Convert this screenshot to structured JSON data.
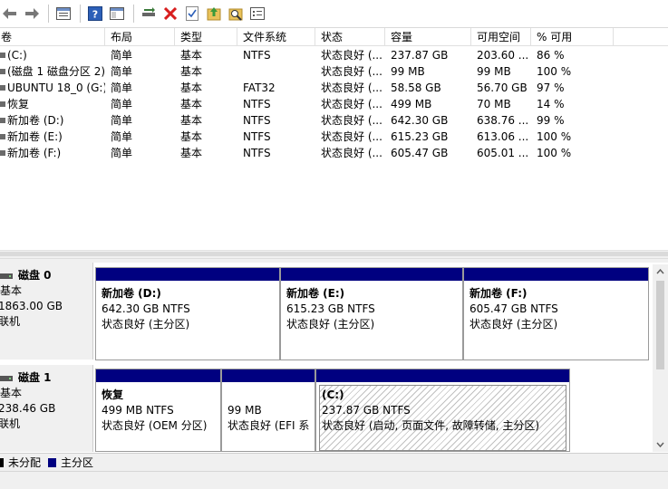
{
  "toolbar": {
    "buttons": [
      "back-icon",
      "forward-icon",
      "view-icon",
      "help-icon",
      "panel-icon",
      "connect-icon",
      "delete-icon",
      "check-icon",
      "refresh-icon",
      "search-icon",
      "properties-icon"
    ]
  },
  "columns": [
    "卷",
    "布局",
    "类型",
    "文件系统",
    "状态",
    "容量",
    "可用空间",
    "% 可用"
  ],
  "rows": [
    {
      "vol": "(C:)",
      "layout": "简单",
      "type": "基本",
      "fs": "NTFS",
      "status": "状态良好 (...",
      "cap": "237.87 GB",
      "free": "203.60 ...",
      "pct": "86 %"
    },
    {
      "vol": "(磁盘 1 磁盘分区 2)",
      "layout": "简单",
      "type": "基本",
      "fs": "",
      "status": "状态良好 (...",
      "cap": "99 MB",
      "free": "99 MB",
      "pct": "100 %"
    },
    {
      "vol": "UBUNTU 18_0 (G:)",
      "layout": "简单",
      "type": "基本",
      "fs": "FAT32",
      "status": "状态良好 (...",
      "cap": "58.58 GB",
      "free": "56.70 GB",
      "pct": "97 %"
    },
    {
      "vol": "恢复",
      "layout": "简单",
      "type": "基本",
      "fs": "NTFS",
      "status": "状态良好 (...",
      "cap": "499 MB",
      "free": "70 MB",
      "pct": "14 %"
    },
    {
      "vol": "新加卷 (D:)",
      "layout": "简单",
      "type": "基本",
      "fs": "NTFS",
      "status": "状态良好 (...",
      "cap": "642.30 GB",
      "free": "638.76 ...",
      "pct": "99 %"
    },
    {
      "vol": "新加卷 (E:)",
      "layout": "简单",
      "type": "基本",
      "fs": "NTFS",
      "status": "状态良好 (...",
      "cap": "615.23 GB",
      "free": "613.06 ...",
      "pct": "100 %"
    },
    {
      "vol": "新加卷 (F:)",
      "layout": "简单",
      "type": "基本",
      "fs": "NTFS",
      "status": "状态良好 (...",
      "cap": "605.47 GB",
      "free": "605.01 ...",
      "pct": "100 %"
    }
  ],
  "disks": [
    {
      "title": "磁盘 0",
      "kind": "基本",
      "size": "1863.00 GB",
      "state": "联机",
      "partitions": [
        {
          "name": "新加卷  (D:)",
          "size": "642.30 GB NTFS",
          "status": "状态良好 (主分区)"
        },
        {
          "name": "新加卷  (E:)",
          "size": "615.23 GB NTFS",
          "status": "状态良好 (主分区)"
        },
        {
          "name": "新加卷  (F:)",
          "size": "605.47 GB NTFS",
          "status": "状态良好 (主分区)"
        }
      ]
    },
    {
      "title": "磁盘 1",
      "kind": "基本",
      "size": "238.46 GB",
      "state": "联机",
      "partitions": [
        {
          "name": "恢复",
          "size": "499 MB NTFS",
          "status": "状态良好 (OEM 分区)"
        },
        {
          "name": "",
          "size": "99 MB",
          "status": "状态良好 (EFI 系"
        },
        {
          "name": "(C:)",
          "size": "237.87 GB NTFS",
          "status": "状态良好 (启动, 页面文件, 故障转储, 主分区)"
        }
      ]
    }
  ],
  "legend": {
    "unallocated": "未分配",
    "primary": "主分区"
  },
  "colors": {
    "primary": "#000080",
    "unallocated": "#000000"
  }
}
